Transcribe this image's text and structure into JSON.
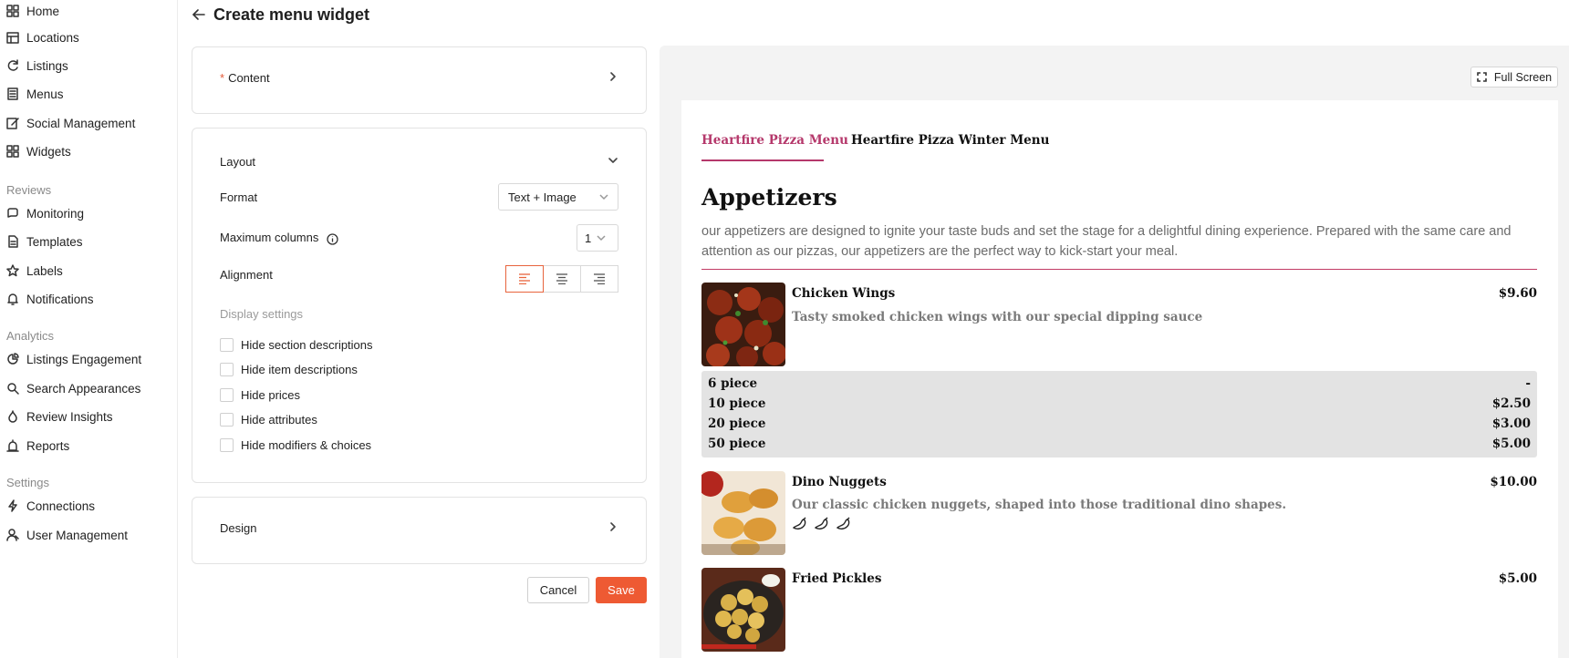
{
  "sidebar": {
    "items_top": [
      {
        "label": "Home",
        "icon": "home-icon"
      },
      {
        "label": "Locations",
        "icon": "locations-icon"
      },
      {
        "label": "Listings",
        "icon": "listings-icon"
      },
      {
        "label": "Menus",
        "icon": "menus-icon"
      },
      {
        "label": "Social Management",
        "icon": "social-icon"
      },
      {
        "label": "Widgets",
        "icon": "widgets-icon"
      }
    ],
    "reviews_heading": "Reviews",
    "items_reviews": [
      {
        "label": "Monitoring",
        "icon": "monitoring-icon"
      },
      {
        "label": "Templates",
        "icon": "templates-icon"
      },
      {
        "label": "Labels",
        "icon": "star-icon"
      },
      {
        "label": "Notifications",
        "icon": "bell-icon"
      }
    ],
    "analytics_heading": "Analytics",
    "items_analytics": [
      {
        "label": "Listings Engagement",
        "icon": "engagement-icon"
      },
      {
        "label": "Search Appearances",
        "icon": "search-icon"
      },
      {
        "label": "Review Insights",
        "icon": "insights-icon"
      },
      {
        "label": "Reports",
        "icon": "reports-icon"
      }
    ],
    "settings_heading": "Settings",
    "items_settings": [
      {
        "label": "Connections",
        "icon": "lightning-icon"
      },
      {
        "label": "User Management",
        "icon": "users-icon"
      }
    ]
  },
  "header": {
    "title": "Create menu widget"
  },
  "content_panel": {
    "label": "Content",
    "required_mark": "*"
  },
  "layout_panel": {
    "title": "Layout",
    "format_label": "Format",
    "format_value": "Text + Image",
    "max_columns_label": "Maximum columns",
    "max_columns_value": "1",
    "alignment_label": "Alignment",
    "alignment_selected": "left",
    "display_settings_label": "Display settings",
    "checkboxes": [
      {
        "label": "Hide section descriptions",
        "checked": false
      },
      {
        "label": "Hide item descriptions",
        "checked": false
      },
      {
        "label": "Hide prices",
        "checked": false
      },
      {
        "label": "Hide attributes",
        "checked": false
      },
      {
        "label": "Hide modifiers & choices",
        "checked": false
      }
    ]
  },
  "design_panel": {
    "label": "Design"
  },
  "actions": {
    "cancel": "Cancel",
    "save": "Save"
  },
  "preview": {
    "fullscreen_label": "Full Screen",
    "tabs": [
      "Heartfire Pizza Menu",
      "Heartfire Pizza Winter Menu"
    ],
    "active_tab": 0,
    "section_title": "Appetizers",
    "section_description": "our appetizers are designed to ignite your taste buds and set the stage for a delightful dining experience. Prepared with the same care and attention as our pizzas, our appetizers are the perfect way to kick-start your meal.",
    "items": [
      {
        "name": "Chicken Wings",
        "price": "$9.60",
        "description": "Tasty smoked chicken wings with our special dipping sauce",
        "modifiers": [
          {
            "name": "6 piece",
            "price": "-"
          },
          {
            "name": "10 piece",
            "price": "$2.50"
          },
          {
            "name": "20 piece",
            "price": "$3.00"
          },
          {
            "name": "50 piece",
            "price": "$5.00"
          }
        ]
      },
      {
        "name": "Dino Nuggets",
        "price": "$10.00",
        "description": "Our classic chicken nuggets, shaped into those traditional dino shapes.",
        "attributes": [
          "pepper-icon",
          "pepper-icon",
          "pepper-icon"
        ]
      },
      {
        "name": "Fried Pickles",
        "price": "$5.00"
      }
    ]
  },
  "colors": {
    "accent": "#ee5a33",
    "menu_accent": "#b5386b",
    "modifier_bg": "#e3e3e3"
  }
}
